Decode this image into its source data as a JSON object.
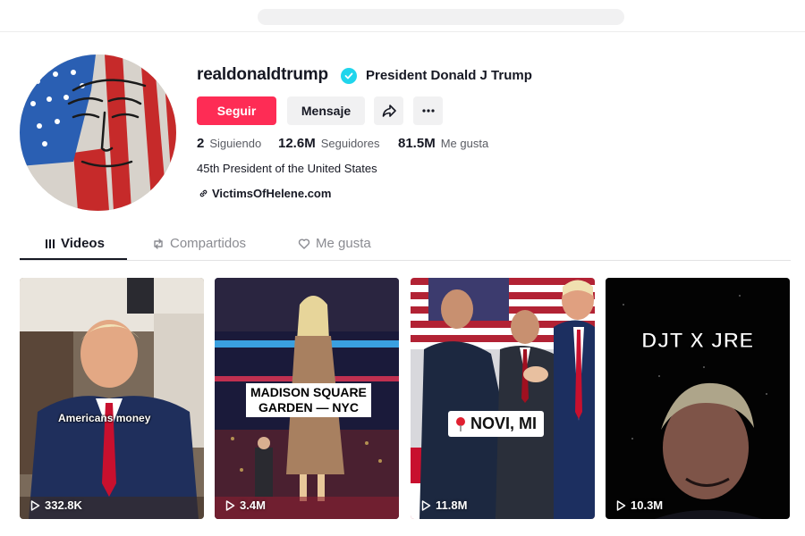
{
  "profile": {
    "username": "realdonaldtrump",
    "nickname": "President Donald J Trump",
    "bio": "45th President of the United States",
    "link": "VictimsOfHelene.com",
    "verified_icon": "verified-badge-icon",
    "accent_color": "#fe2c55",
    "verified_color": "#20d5ec"
  },
  "actions": {
    "follow_label": "Seguir",
    "message_label": "Mensaje",
    "share_icon": "share-icon",
    "more_icon": "more-icon"
  },
  "stats": {
    "following_count": "2",
    "following_label": "Siguiendo",
    "followers_count": "12.6M",
    "followers_label": "Seguidores",
    "likes_count": "81.5M",
    "likes_label": "Me gusta"
  },
  "tabs": [
    {
      "label": "Videos",
      "icon": "grid-icon",
      "active": true
    },
    {
      "label": "Compartidos",
      "icon": "repost-icon",
      "active": false
    },
    {
      "label": "Me gusta",
      "icon": "heart-icon",
      "active": false
    }
  ],
  "videos": [
    {
      "views": "332.8K",
      "caption": "Americans money"
    },
    {
      "views": "3.4M",
      "caption_line1": "MADISON SQUARE",
      "caption_line2": "GARDEN — NYC"
    },
    {
      "views": "11.8M",
      "caption": "NOVI, MI"
    },
    {
      "views": "10.3M",
      "caption": "DJT X JRE"
    }
  ]
}
